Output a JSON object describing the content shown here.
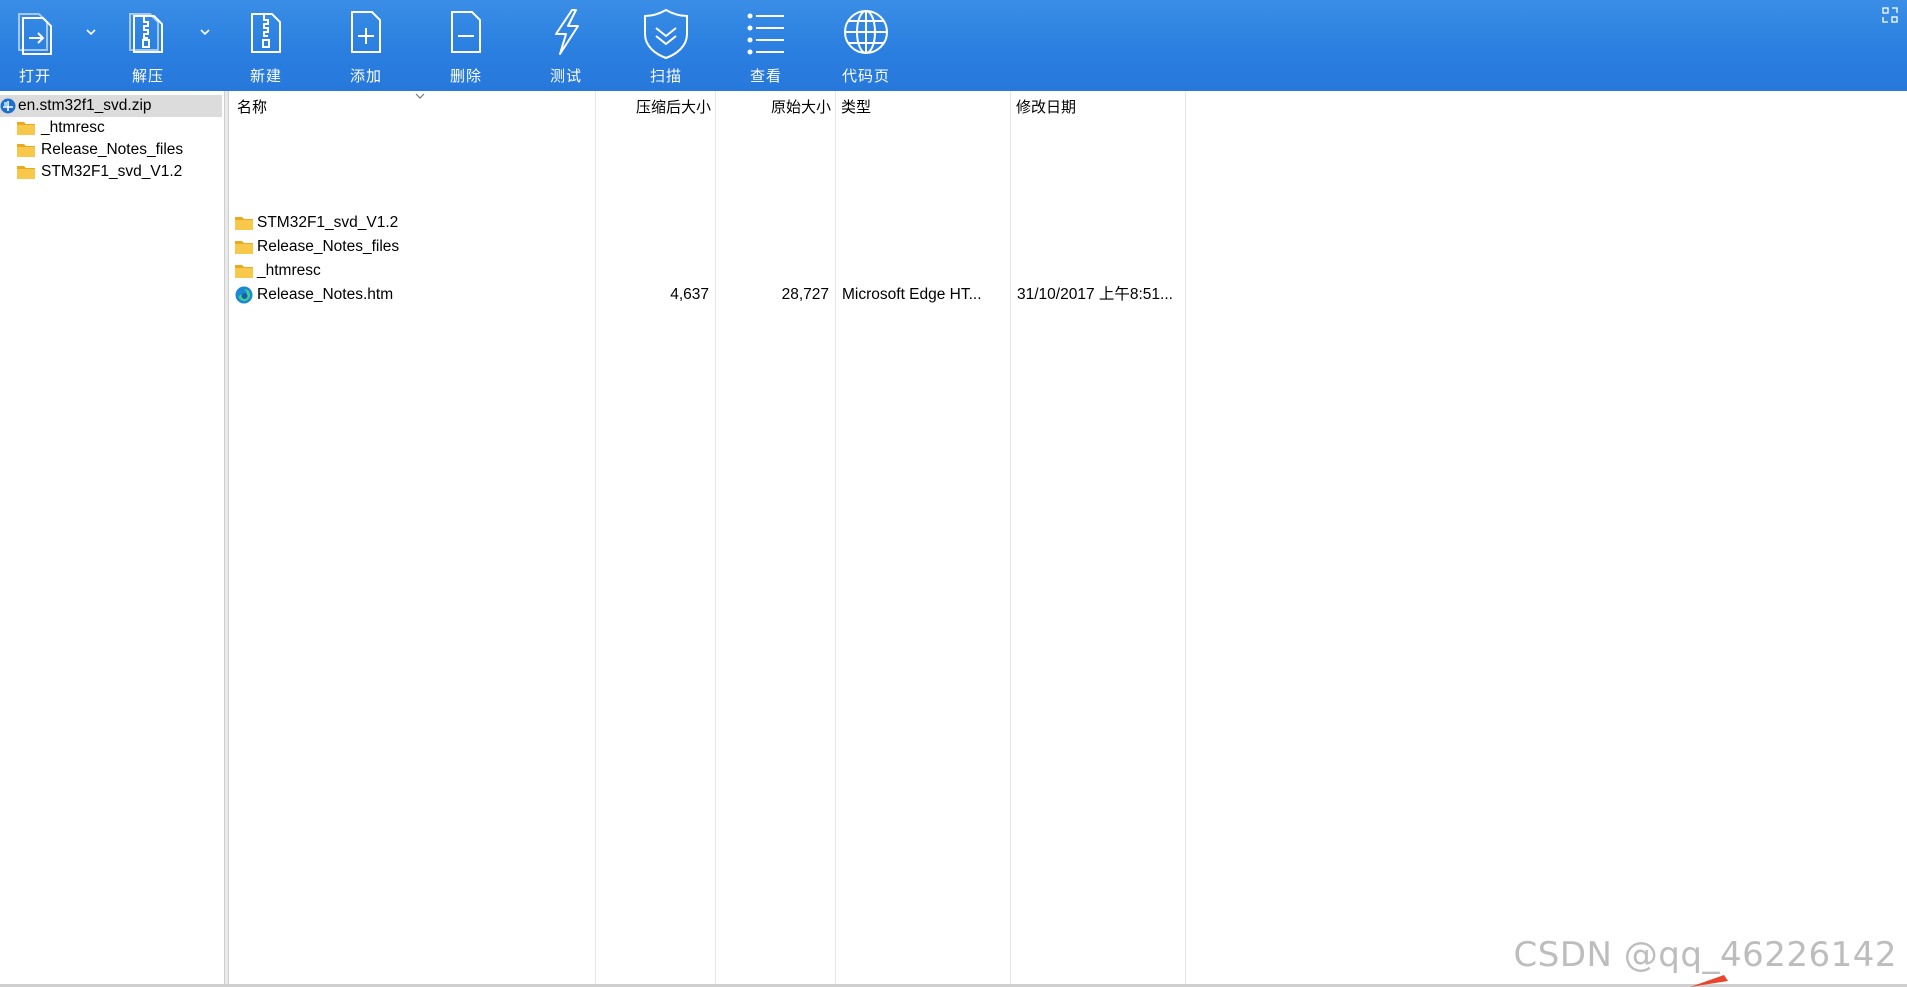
{
  "toolbar": {
    "open": "打开",
    "extract": "解压",
    "new": "新建",
    "add": "添加",
    "delete": "删除",
    "test": "测试",
    "scan": "扫描",
    "view": "查看",
    "codepage": "代码页"
  },
  "tree": {
    "root": "en.stm32f1_svd.zip",
    "items": [
      "_htmresc",
      "Release_Notes_files",
      "STM32F1_svd_V1.2"
    ]
  },
  "columns": {
    "name": "名称",
    "packed": "压缩后大小",
    "size": "原始大小",
    "type": "类型",
    "modified": "修改日期"
  },
  "files": [
    {
      "name": "STM32F1_svd_V1.2",
      "packed": "",
      "size": "",
      "type": "",
      "modified": "",
      "icon": "folder-icon"
    },
    {
      "name": "Release_Notes_files",
      "packed": "",
      "size": "",
      "type": "",
      "modified": "",
      "icon": "folder-icon"
    },
    {
      "name": "_htmresc",
      "packed": "",
      "size": "",
      "type": "",
      "modified": "",
      "icon": "folder-icon"
    },
    {
      "name": "Release_Notes.htm",
      "packed": "4,637",
      "size": "28,727",
      "type": "Microsoft Edge HT...",
      "modified": "31/10/2017 上午8:51...",
      "icon": "edge-icon"
    }
  ],
  "watermark": "CSDN @qq_46226142",
  "colors": {
    "toolbar": "#2a7fe0",
    "folder": "#f5c242",
    "selection": "#dcdcdc"
  }
}
